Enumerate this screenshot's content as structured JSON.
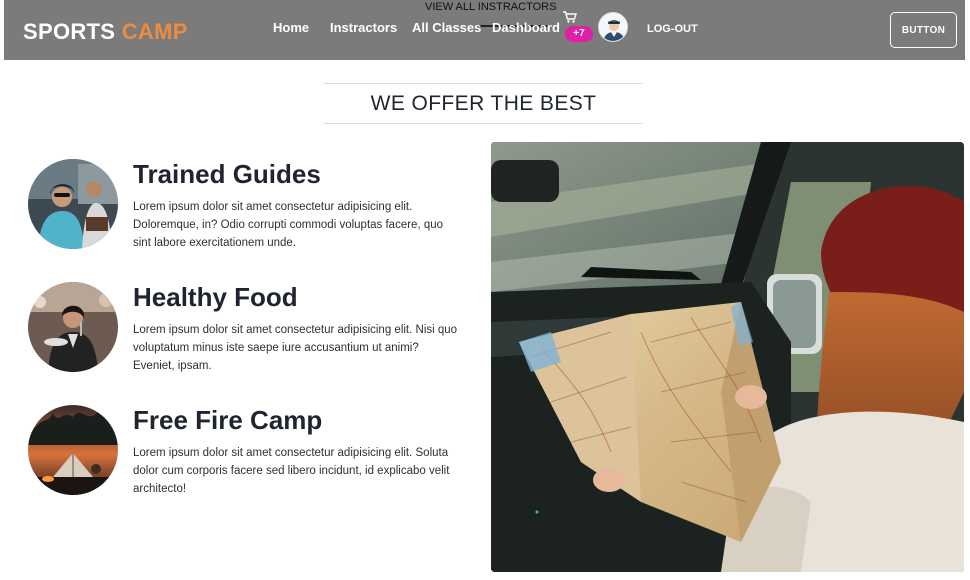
{
  "navbar": {
    "logo_main": "SPORTS",
    "logo_accent": "CAMP",
    "links": [
      "Home",
      "Instractors",
      "All Classes",
      "Dashboard"
    ],
    "dropdown_label": "VIEW ALL INSTRACTORS",
    "cart_icon": "cart-icon",
    "cart_badge": "+7",
    "logout": "LOG-OUT",
    "button_label": "BUTTON"
  },
  "section": {
    "title": "WE OFFER THE BEST"
  },
  "features": [
    {
      "title": "Trained Guides",
      "description": "Lorem ipsum dolor sit amet consectetur adipisicing elit. Doloremque, in? Odio corrupti commodi voluptas facere, quo sint labore exercitationem unde."
    },
    {
      "title": "Healthy Food",
      "description": "Lorem ipsum dolor sit amet consectetur adipisicing elit. Nisi quo voluptatum minus iste saepe iure accusantium ut animi? Eveniet, ipsam."
    },
    {
      "title": "Free Fire Camp",
      "description": "Lorem ipsum dolor sit amet consectetur adipisicing elit. Soluta dolor cum corporis facere sed libero incidunt, id explicabo velit architecto!"
    }
  ],
  "colors": {
    "navbar_bg": "#7b7b7b",
    "logo_accent": "#f08a3c",
    "badge": "#e01ea8",
    "text_dark": "#1f2430"
  }
}
